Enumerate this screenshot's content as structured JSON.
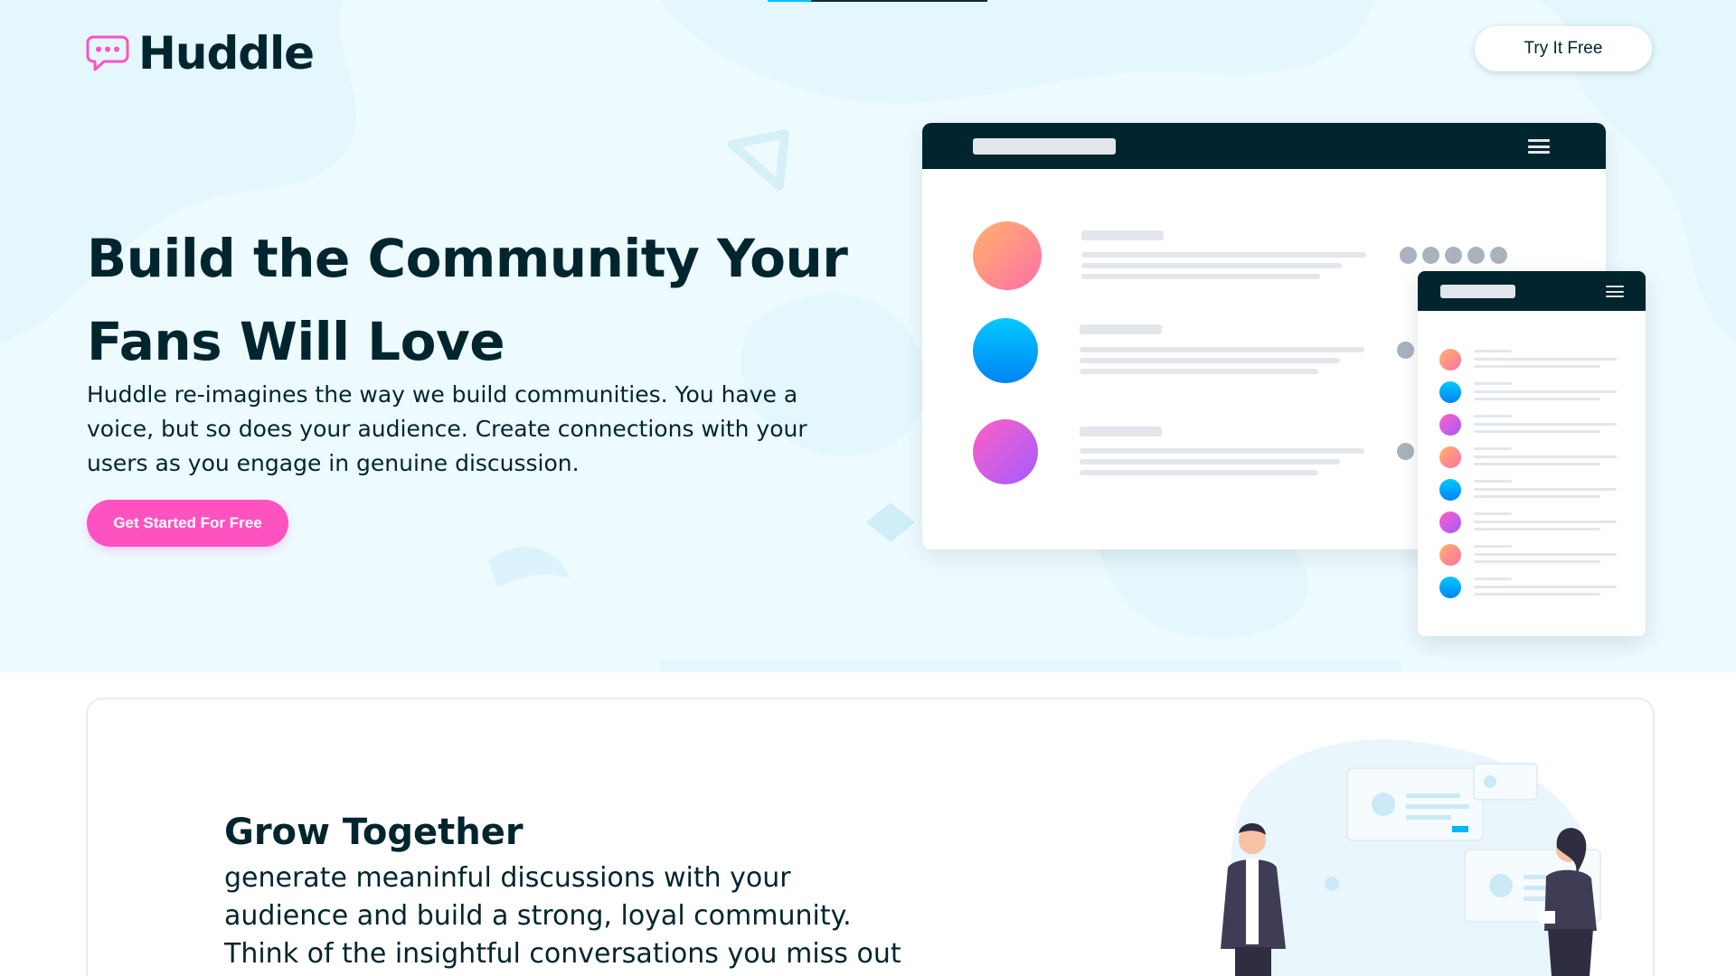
{
  "header": {
    "logo_text": "Huddle",
    "try_button": "Try It Free"
  },
  "hero": {
    "title": "Build the Community Your Fans Will Love",
    "description": "Huddle re-imagines the way we build communities. You have a voice, but so does your audience. Create connections with your users as you engage in genuine discussion.",
    "cta_button": "Get Started For Free"
  },
  "features": [
    {
      "title": "Grow Together",
      "description": "generate meaninful discussions with your audience and build a strong, loyal community. Think of the insightful conversations you miss out on with a"
    }
  ],
  "colors": {
    "primary_dark": "#00252e",
    "accent_pink": "#ff52c1",
    "hero_bg": "#edfbff",
    "avatar_orange": "#ff9a72",
    "avatar_blue": "#00a3f5",
    "avatar_purple": "#c743e2"
  },
  "icons": {
    "logo": "speech-bubble-icon",
    "menu": "hamburger-menu-icon"
  }
}
